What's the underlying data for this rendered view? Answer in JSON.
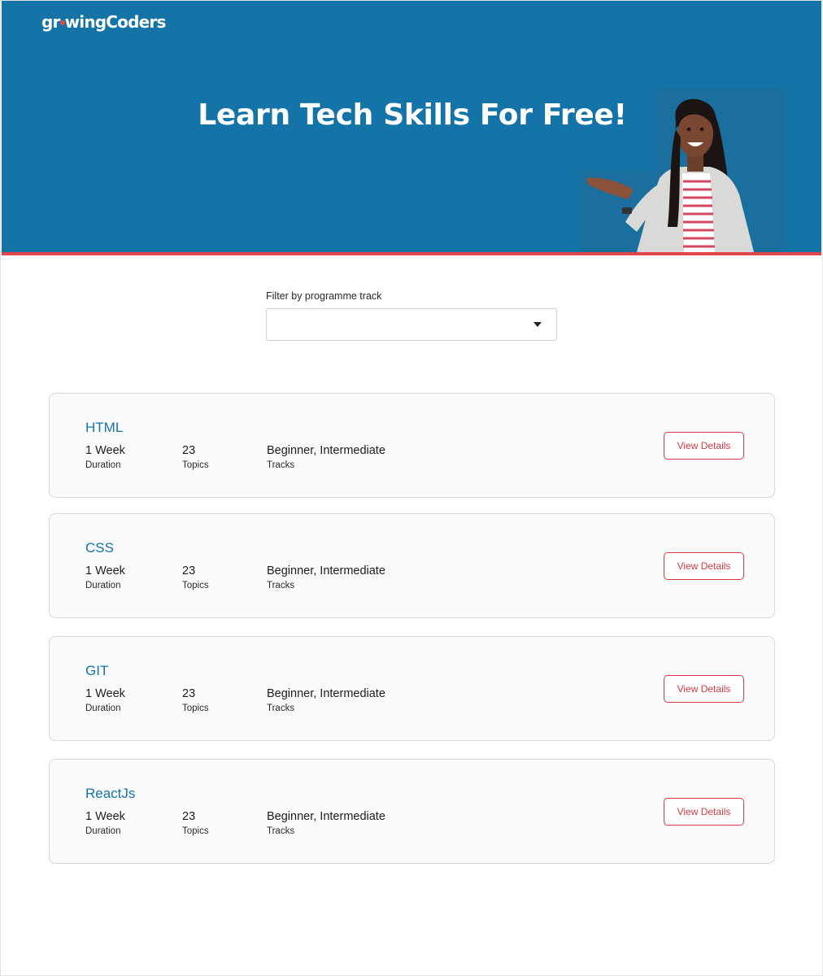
{
  "brand": {
    "logo_text_before": "gr",
    "logo_text_after": "wingCoders",
    "accent_color": "#1474a8",
    "highlight_color": "#e0474c"
  },
  "hero": {
    "title": "Learn Tech Skills For Free!"
  },
  "filter": {
    "label": "Filter by programme track",
    "selected_value": ""
  },
  "courses": [
    {
      "title": "HTML",
      "duration_value": "1 Week",
      "duration_label": "Duration",
      "topics_value": "23",
      "topics_label": "Topics",
      "tracks_value": "Beginner, Intermediate",
      "tracks_label": "Tracks",
      "button_label": "View Details"
    },
    {
      "title": "CSS",
      "duration_value": "1 Week",
      "duration_label": "Duration",
      "topics_value": "23",
      "topics_label": "Topics",
      "tracks_value": "Beginner, Intermediate",
      "tracks_label": "Tracks",
      "button_label": "View Details"
    },
    {
      "title": "GIT",
      "duration_value": "1 Week",
      "duration_label": "Duration",
      "topics_value": "23",
      "topics_label": "Topics",
      "tracks_value": "Beginner, Intermediate",
      "tracks_label": "Tracks",
      "button_label": "View Details"
    },
    {
      "title": "ReactJs",
      "duration_value": "1 Week",
      "duration_label": "Duration",
      "topics_value": "23",
      "topics_label": "Topics",
      "tracks_value": "Beginner, Intermediate",
      "tracks_label": "Tracks",
      "button_label": "View Details"
    }
  ]
}
